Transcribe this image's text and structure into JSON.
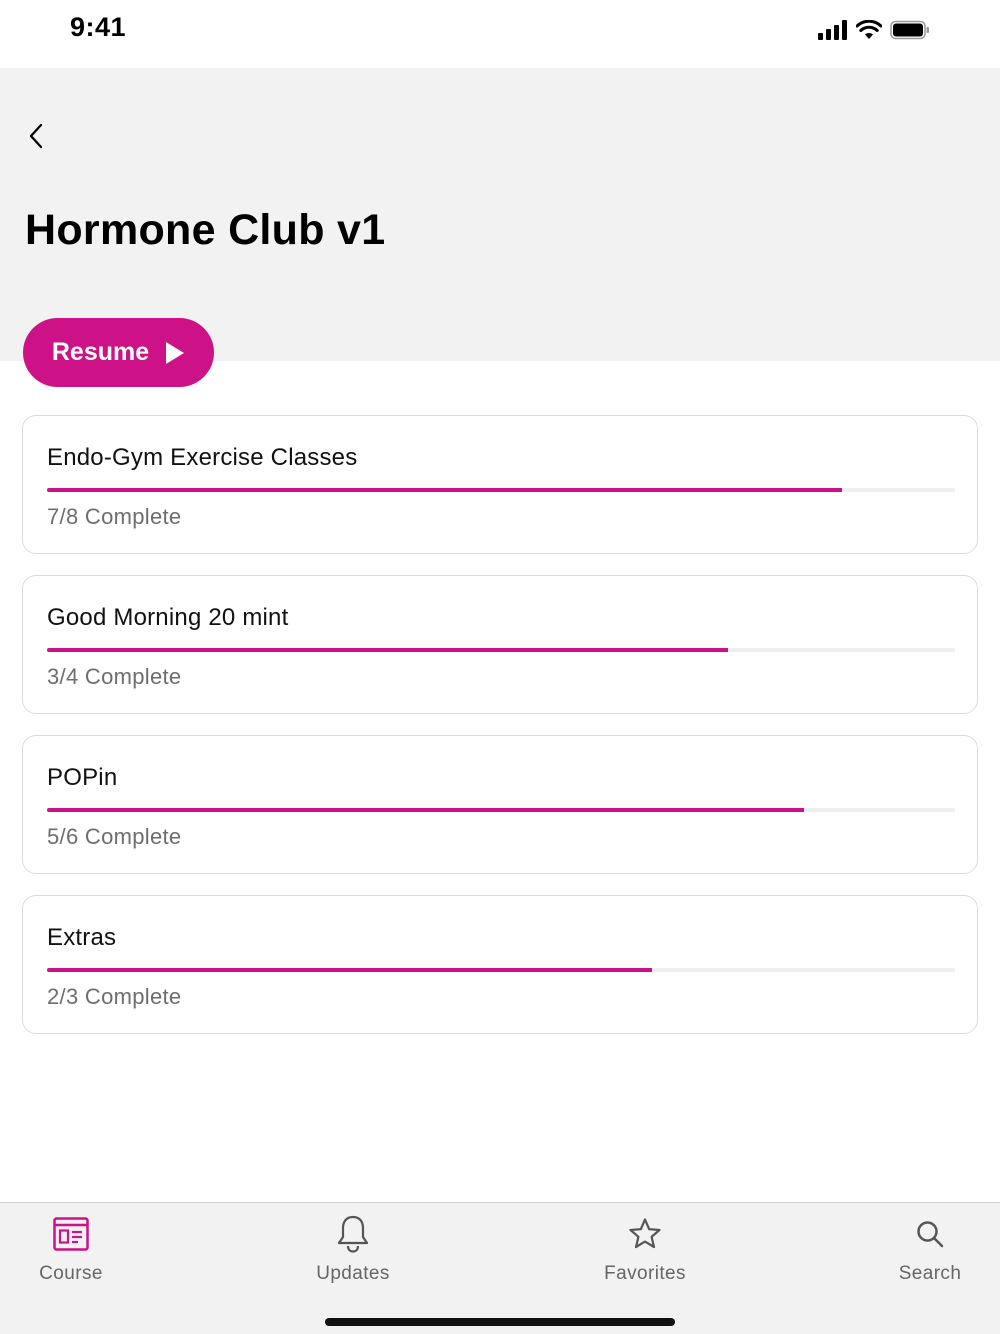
{
  "status_bar": {
    "time": "9:41"
  },
  "header": {
    "title": "Hormone Club v1"
  },
  "resume_button": {
    "label": "Resume"
  },
  "courses": [
    {
      "title": "Endo-Gym Exercise Classes",
      "status": "7/8 Complete",
      "completed": 7,
      "total": 8
    },
    {
      "title": "Good Morning 20 mint",
      "status": "3/4 Complete",
      "completed": 3,
      "total": 4
    },
    {
      "title": "POPin",
      "status": "5/6 Complete",
      "completed": 5,
      "total": 6
    },
    {
      "title": "Extras",
      "status": "2/3 Complete",
      "completed": 2,
      "total": 3
    }
  ],
  "tab_bar": {
    "tabs": [
      {
        "label": "Course",
        "icon": "course-icon",
        "active": true
      },
      {
        "label": "Updates",
        "icon": "bell-icon",
        "active": false
      },
      {
        "label": "Favorites",
        "icon": "star-icon",
        "active": false
      },
      {
        "label": "Search",
        "icon": "search-icon",
        "active": false
      }
    ]
  },
  "colors": {
    "accent": "#cc1286",
    "header_bg": "#f2f2f2",
    "muted_text": "#6e6e6e"
  }
}
